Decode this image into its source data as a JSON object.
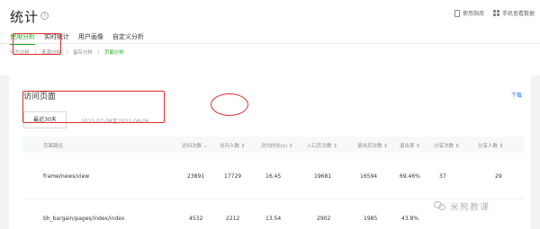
{
  "page_title": "统计",
  "header_links": [
    "使用指南",
    "手机查看数据"
  ],
  "tabs": [
    "使用分析",
    "实时统计",
    "用户画像",
    "自定义分析"
  ],
  "subtabs": [
    "行为分析",
    "来源分析",
    "留存分析",
    "页面分析"
  ],
  "card_title": "访问页面",
  "download_label": "下载",
  "range_button": "最近30天",
  "date_range": "2021-07-08至2021-08-06",
  "columns": [
    "页面路径",
    "访问次数 ⌄",
    "访问人数 ⇕",
    "次均时长(s) ⇕",
    "入口页次数 ⇕",
    "退出页次数 ⇕",
    "退出率 ⇕",
    "分享次数 ⇕",
    "分享人数 ⇕"
  ],
  "rows": [
    [
      "frame/news/view",
      "23891",
      "17729",
      "16.45",
      "19681",
      "16594",
      "69.46%",
      "37",
      "29"
    ],
    [
      "bh_bargain/pages/index/index",
      "4532",
      "2212",
      "13.54",
      "2902",
      "1985",
      "43.8%",
      "",
      ""
    ]
  ],
  "watermark": "米熊教课",
  "colors": {
    "accent": "#1aad19",
    "highlight": "#e02d2d",
    "link": "#2d78f4"
  }
}
